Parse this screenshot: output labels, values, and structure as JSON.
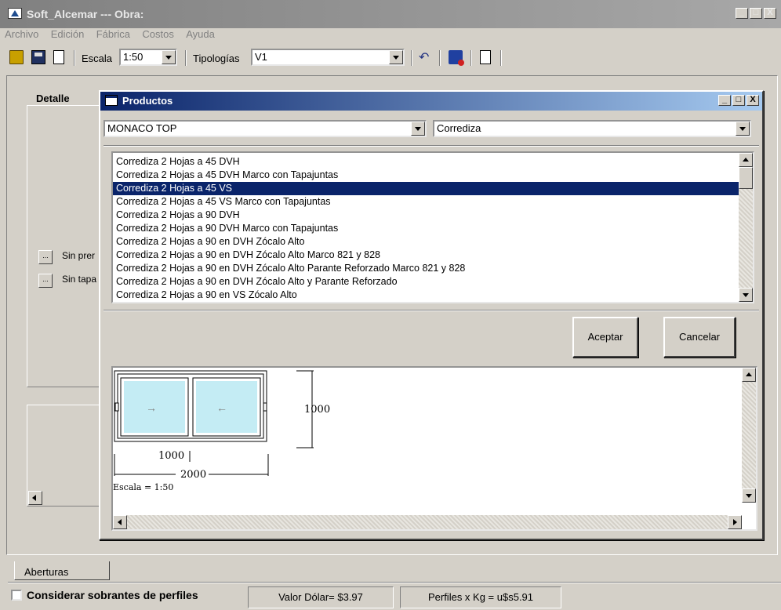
{
  "window": {
    "title": "Soft_Alcemar --- Obra:",
    "min": "_",
    "max": "□",
    "close": "X"
  },
  "menu": [
    "Archivo",
    "Edición",
    "Fábrica",
    "Costos",
    "Ayuda"
  ],
  "toolbar": {
    "escala_label": "Escala",
    "escala_value": "1:50",
    "tipologias_label": "Tipologías",
    "tipologias_value": "V1"
  },
  "detail": {
    "tab_label": "Detalle",
    "option1_label": "Sin prer",
    "option2_label": "Sin tapa",
    "dots": "..."
  },
  "dialog": {
    "title": "Productos",
    "line_value": "MONACO TOP",
    "type_value": "Corrediza",
    "items": [
      "Corrediza 2 Hojas a 45 DVH",
      "Corrediza 2 Hojas a 45 DVH Marco con Tapajuntas",
      "Corrediza 2 Hojas a 45 VS",
      "Corrediza 2 Hojas a 45 VS Marco con Tapajuntas",
      "Corrediza 2 Hojas a 90 DVH",
      "Corrediza 2 Hojas a 90 DVH Marco con Tapajuntas",
      "Corrediza 2 Hojas a 90 en DVH Zócalo Alto",
      "Corrediza 2 Hojas a 90 en DVH Zócalo Alto Marco 821 y 828",
      "Corrediza 2 Hojas a 90 en DVH Zócalo Alto Parante Reforzado Marco 821 y 828",
      "Corrediza 2 Hojas a 90 en DVH Zócalo Alto y Parante Reforzado",
      "Corrediza 2 Hojas a 90 en VS Zócalo Alto"
    ],
    "selected_index": 2,
    "accept_label": "Aceptar",
    "cancel_label": "Cancelar",
    "preview": {
      "height_dim": "1000",
      "leaf_width_dim": "1000",
      "total_width_dim": "2000",
      "scale_text": "Escala = 1:50",
      "arrow_right": "→",
      "arrow_left": "←"
    }
  },
  "tabs": {
    "aberturas": "Aberturas"
  },
  "status": {
    "checkbox_label": "Considerar sobrantes de perfiles",
    "checkbox_checked": false,
    "dolar": "Valor Dólar= $3.97",
    "perfiles": "Perfiles x Kg = u$s5.91"
  },
  "colors": {
    "dialog_title_start": "#0a246a",
    "dialog_title_end": "#a6caf0",
    "selection": "#0a246a",
    "glass": "#c4ecf4"
  }
}
